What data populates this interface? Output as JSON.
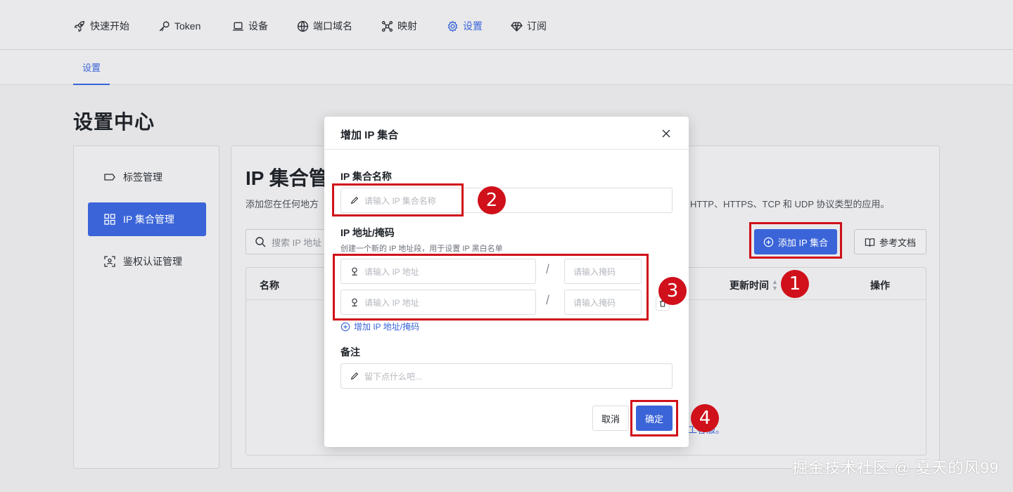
{
  "nav": {
    "items": [
      {
        "label": "快速开始",
        "icon": "rocket-icon"
      },
      {
        "label": "Token",
        "icon": "key-icon"
      },
      {
        "label": "设备",
        "icon": "laptop-icon"
      },
      {
        "label": "端口域名",
        "icon": "globe-icon"
      },
      {
        "label": "映射",
        "icon": "network-icon"
      },
      {
        "label": "设置",
        "icon": "gear-icon",
        "active": true
      },
      {
        "label": "订阅",
        "icon": "diamond-icon"
      }
    ]
  },
  "subnav": {
    "tab": "设置"
  },
  "page": {
    "title": "设置中心"
  },
  "sidebar": {
    "items": [
      {
        "label": "标签管理",
        "icon": "tag-icon"
      },
      {
        "label": "IP 集合管理",
        "icon": "grid-icon",
        "active": true
      },
      {
        "label": "鉴权认证管理",
        "icon": "face-scan-icon"
      }
    ]
  },
  "main": {
    "title": "IP 集合管",
    "desc": "添加您在任何地方",
    "desc_tail": "HTTP、HTTPS、TCP 和 UDP 协议类型的应用。",
    "search_placeholder": "搜索 IP 地址",
    "add_button": "添加 IP 集合",
    "doc_button": "参考文档",
    "table": {
      "headers": [
        "名称",
        "更新时间",
        "操作"
      ],
      "empty_link": "工客服。"
    }
  },
  "modal": {
    "title": "增加 IP 集合",
    "name_label": "IP 集合名称",
    "name_placeholder": "请输入 IP 集合名称",
    "ip_label": "IP 地址/掩码",
    "ip_help": "创建一个新的 IP 地址段，用于设置 IP 黑白名单",
    "ip_placeholder": "请输入 IP 地址",
    "mask_placeholder": "请输入掩码",
    "slash": "/",
    "add_row": "增加 IP 地址/掩码",
    "note_label": "备注",
    "note_placeholder": "留下点什么吧...",
    "cancel": "取消",
    "ok": "确定"
  },
  "annotations": [
    "1",
    "2",
    "3",
    "4"
  ],
  "watermark": "掘金技术社区 @ 夏天的风99",
  "colors": {
    "accent": "#3a64d8",
    "annotation": "#d0101a"
  }
}
